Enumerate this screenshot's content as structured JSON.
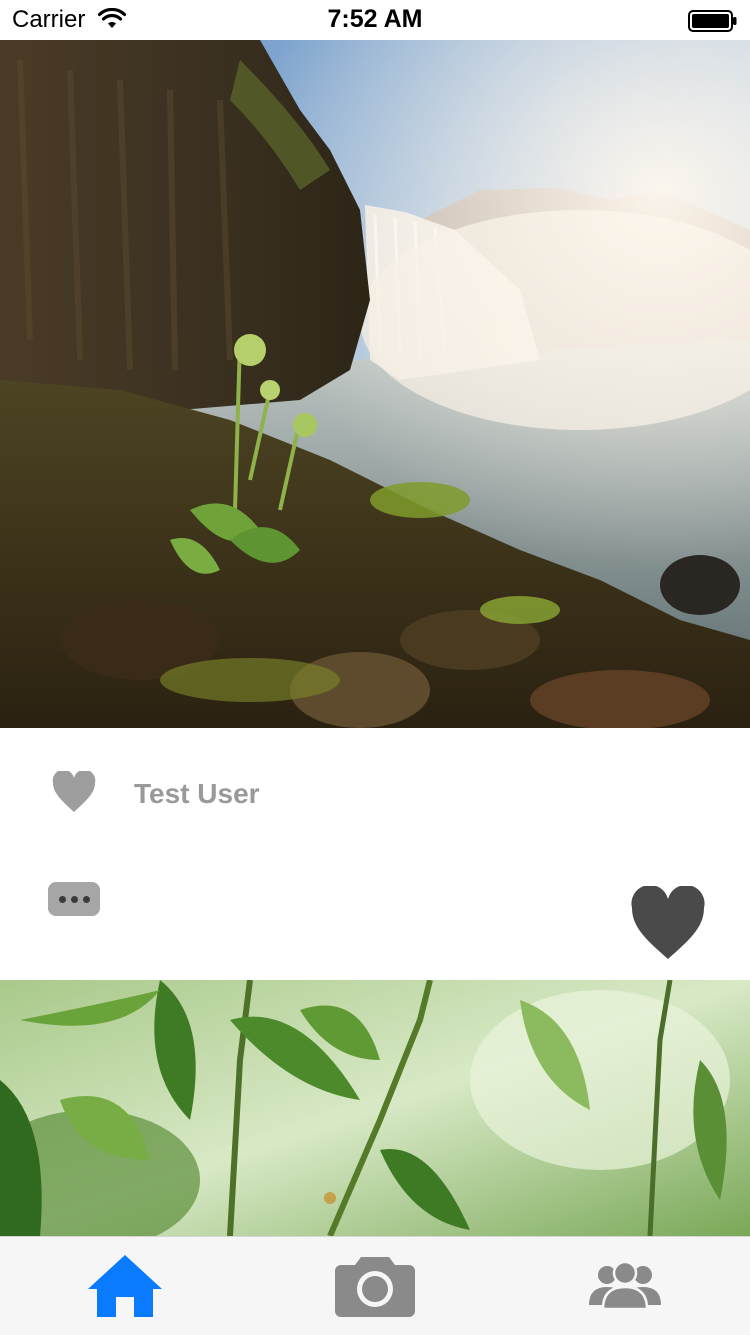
{
  "status_bar": {
    "carrier": "Carrier",
    "time": "7:52 AM",
    "wifi_icon": "wifi-icon",
    "battery_icon": "battery-icon"
  },
  "feed": {
    "posts": [
      {
        "image_subject": "waterfall-landscape",
        "username": "Test User",
        "user_icon": "heart-icon",
        "more_icon": "ellipsis-icon",
        "like_icon": "heart-icon"
      },
      {
        "image_subject": "green-leaves"
      }
    ]
  },
  "tab_bar": {
    "tabs": [
      {
        "icon": "home-icon",
        "selected": true
      },
      {
        "icon": "camera-icon",
        "selected": false
      },
      {
        "icon": "people-icon",
        "selected": false
      }
    ]
  },
  "colors": {
    "accent": "#0a7aff",
    "icon_gray": "#8a8a8a",
    "username_gray": "#999999",
    "like_heart": "#4a4a4a"
  }
}
